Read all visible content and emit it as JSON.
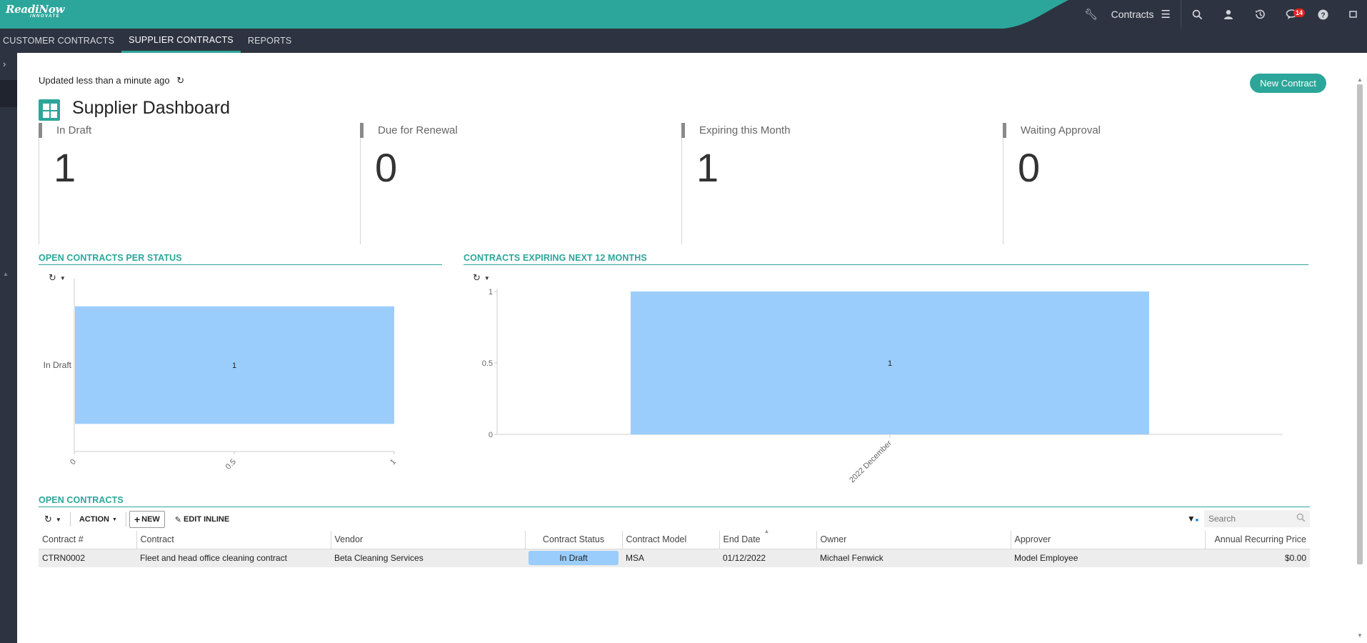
{
  "brand": {
    "name": "ReadiNow",
    "tagline": "INNOVATE",
    "color": "#2ca69a"
  },
  "topbar": {
    "app_name": "Contracts",
    "notifications_count": "14",
    "icons": [
      "wrench-icon",
      "menu-icon",
      "search-icon",
      "user-icon",
      "history-icon",
      "chat-icon",
      "help-icon",
      "window-icon"
    ]
  },
  "nav": {
    "tabs": [
      {
        "label": "CUSTOMER CONTRACTS",
        "active": false
      },
      {
        "label": "SUPPLIER CONTRACTS",
        "active": true
      },
      {
        "label": "REPORTS",
        "active": false
      }
    ]
  },
  "dashboard": {
    "updated_text": "Updated less than a minute ago",
    "new_button": "New Contract",
    "title": "Supplier Dashboard",
    "kpis": [
      {
        "label": "In Draft",
        "value": "1"
      },
      {
        "label": "Due for Renewal",
        "value": "0"
      },
      {
        "label": "Expiring this Month",
        "value": "1"
      },
      {
        "label": "Waiting Approval",
        "value": "0"
      }
    ]
  },
  "chart_data": [
    {
      "type": "bar",
      "orientation": "horizontal",
      "title": "OPEN CONTRACTS PER STATUS",
      "categories": [
        "In Draft"
      ],
      "values": [
        1
      ],
      "data_labels": [
        "1"
      ],
      "xlim": [
        0,
        1
      ],
      "x_ticks": [
        "0",
        "0.5",
        "1"
      ],
      "bar_color": "#9acdfc"
    },
    {
      "type": "bar",
      "orientation": "vertical",
      "title": "CONTRACTS EXPIRING NEXT 12 MONTHS",
      "categories": [
        "2022 December"
      ],
      "values": [
        1
      ],
      "data_labels": [
        "1"
      ],
      "ylim": [
        0,
        1
      ],
      "y_ticks": [
        "0",
        "0.5",
        "1"
      ],
      "bar_color": "#9acdfc"
    }
  ],
  "open_contracts": {
    "title": "OPEN CONTRACTS",
    "toolbar": {
      "action": "ACTION",
      "new": "NEW",
      "edit_inline": "EDIT INLINE",
      "search_placeholder": "Search"
    },
    "columns": [
      "Contract #",
      "Contract",
      "Vendor",
      "Contract Status",
      "Contract Model",
      "End Date",
      "Owner",
      "Approver",
      "Annual Recurring Price"
    ],
    "rows": [
      {
        "number": "CTRN0002",
        "contract": "Fleet and head office cleaning contract",
        "vendor": "Beta Cleaning Services",
        "status": "In Draft",
        "model": "MSA",
        "end_date": "01/12/2022",
        "owner": "Michael Fenwick",
        "approver": "Model Employee",
        "price": "$0.00"
      }
    ]
  }
}
